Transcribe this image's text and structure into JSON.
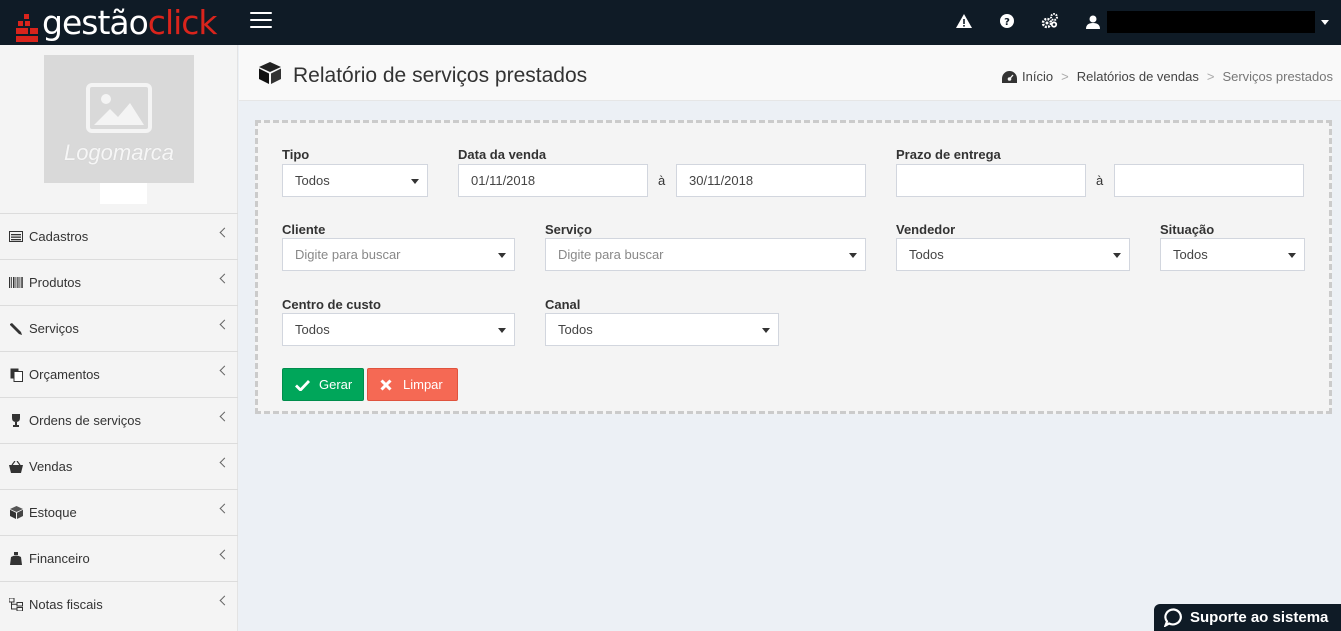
{
  "brand": {
    "part1": "gestão",
    "part2": "click",
    "red": "#d9241c",
    "topbar_bg": "#0f1b26"
  },
  "topbar": {
    "icons": [
      "warning-icon",
      "help-icon",
      "settings-icon",
      "user-icon"
    ]
  },
  "sidebar": {
    "logo_placeholder": "Logomarca",
    "items": [
      {
        "label": "Cadastros",
        "icon": "list-card-icon"
      },
      {
        "label": "Produtos",
        "icon": "barcode-icon"
      },
      {
        "label": "Serviços",
        "icon": "tools-icon"
      },
      {
        "label": "Orçamentos",
        "icon": "copy-docs-icon"
      },
      {
        "label": "Ordens de serviços",
        "icon": "trophy-icon"
      },
      {
        "label": "Vendas",
        "icon": "basket-icon"
      },
      {
        "label": "Estoque",
        "icon": "cube-icon"
      },
      {
        "label": "Financeiro",
        "icon": "money-bag-icon"
      },
      {
        "label": "Notas fiscais",
        "icon": "sitemap-icon"
      }
    ]
  },
  "header": {
    "title": "Relatório de serviços prestados",
    "breadcrumb": {
      "home": "Início",
      "section": "Relatórios de vendas",
      "current": "Serviços prestados"
    }
  },
  "form": {
    "tipo": {
      "label": "Tipo",
      "value": "Todos"
    },
    "data_venda": {
      "label": "Data da venda",
      "from": "01/11/2018",
      "to": "30/11/2018",
      "between": "à"
    },
    "prazo_entrega": {
      "label": "Prazo de entrega",
      "from": "",
      "to": "",
      "between": "à"
    },
    "cliente": {
      "label": "Cliente",
      "placeholder": "Digite para buscar"
    },
    "servico": {
      "label": "Serviço",
      "placeholder": "Digite para buscar"
    },
    "vendedor": {
      "label": "Vendedor",
      "value": "Todos"
    },
    "situacao": {
      "label": "Situação",
      "value": "Todos"
    },
    "centro_custo": {
      "label": "Centro de custo",
      "value": "Todos"
    },
    "canal": {
      "label": "Canal",
      "value": "Todos"
    },
    "buttons": {
      "generate": "Gerar",
      "clear": "Limpar"
    },
    "colors": {
      "green": "#00a65a",
      "red": "#f56954"
    }
  },
  "support": {
    "label": "Suporte ao sistema"
  }
}
